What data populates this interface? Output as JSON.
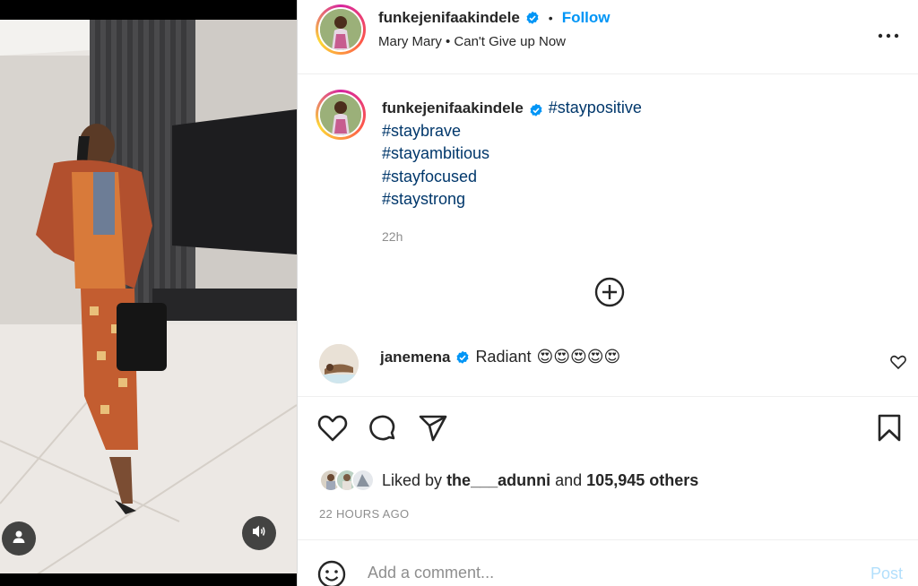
{
  "post": {
    "username": "funkejenifaakindele",
    "follow_label": "Follow",
    "audio": "Mary Mary • Can't Give up Now",
    "separator": "•"
  },
  "caption": {
    "username": "funkejenifaakindele",
    "hashtags": [
      "#staypositive",
      "#staybrave",
      "#stayambitious",
      "#stayfocused",
      "#staystrong"
    ],
    "time": "22h"
  },
  "comment": {
    "username": "janemena",
    "text": "Radiant",
    "emojis": "😍😍😍😍😍"
  },
  "likes": {
    "prefix": "Liked by",
    "user": "the___adunni",
    "conj": "and",
    "others": "105,945 others"
  },
  "post_age": "22 HOURS AGO",
  "add_comment": {
    "placeholder": "Add a comment...",
    "post_label": "Post"
  },
  "icons": {
    "verified": "verified-badge-icon",
    "more": "more-options-icon",
    "plus": "load-more-comments-icon",
    "heart": "heart-icon",
    "comment": "comment-icon",
    "share": "share-icon",
    "save": "bookmark-icon",
    "emoji": "emoji-icon",
    "tag": "user-tag-icon",
    "sound": "sound-icon"
  },
  "colors": {
    "link_blue": "#0095f6",
    "hashtag": "#00376b",
    "verified": "#0095f6",
    "muted": "#8e8e8e",
    "post_disabled": "#b2dffc"
  }
}
